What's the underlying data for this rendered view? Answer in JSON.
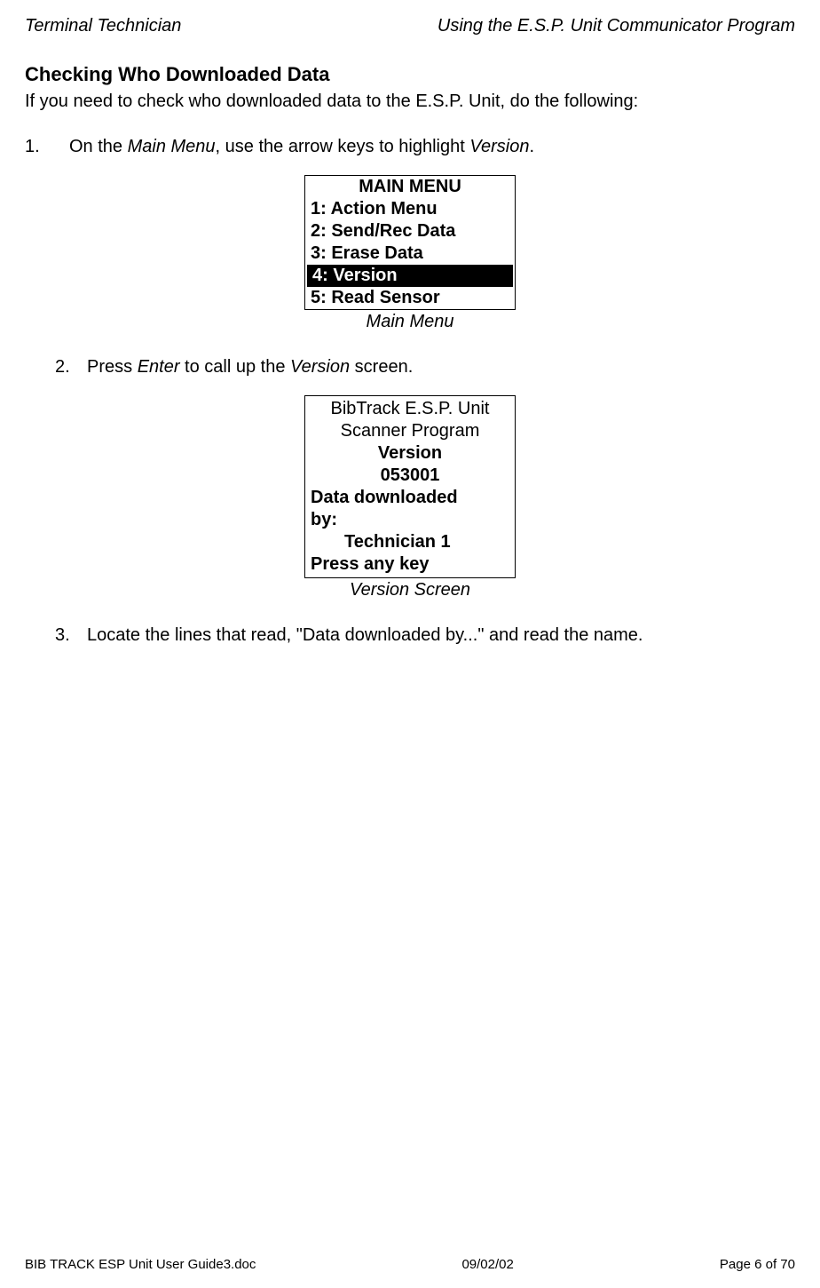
{
  "header": {
    "left": "Terminal Technician",
    "right": "Using the E.S.P. Unit Communicator Program"
  },
  "section_heading": "Checking Who Downloaded Data",
  "intro": "If you need to check who downloaded data to the E.S.P. Unit, do the following:",
  "step1": {
    "num": "1.",
    "text_a": "On the ",
    "text_b": "Main Menu",
    "text_c": ", use the arrow keys to highlight ",
    "text_d": "Version",
    "text_e": "."
  },
  "main_menu": {
    "title": "MAIN MENU",
    "item1": "1: Action Menu",
    "item2": "2: Send/Rec Data",
    "item3": "3: Erase Data",
    "item4": "4: Version",
    "item5": "5: Read Sensor",
    "caption": "Main Menu"
  },
  "step2": {
    "num": "2.",
    "text_a": "Press ",
    "text_b": "Enter",
    "text_c": " to call up the ",
    "text_d": "Version",
    "text_e": " screen."
  },
  "version_screen": {
    "line1": "BibTrack E.S.P. Unit",
    "line2": "Scanner Program",
    "line3": "Version",
    "line4": "053001",
    "line5": "Data downloaded",
    "line6": "by:",
    "line7": "Technician 1",
    "line8": "Press any key",
    "caption": "Version Screen"
  },
  "step3": {
    "num": "3.",
    "text": "Locate the lines that read, \"Data downloaded by...\" and read the name."
  },
  "footer": {
    "left": "BIB TRACK  ESP Unit User Guide3.doc",
    "center": "09/02/02",
    "right": "Page 6 of 70"
  }
}
